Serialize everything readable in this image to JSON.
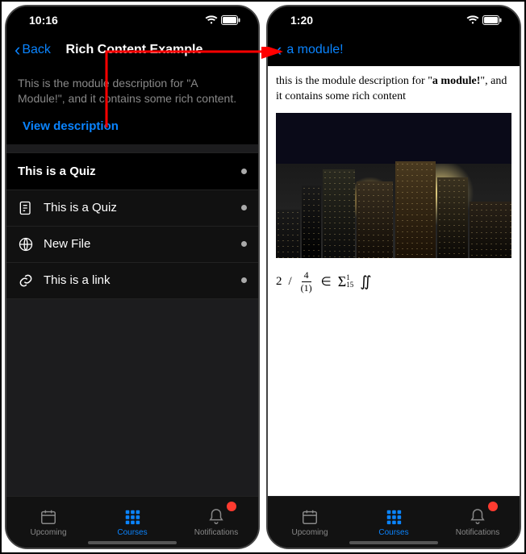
{
  "left": {
    "status_time": "10:16",
    "back_label": "Back",
    "title": "Rich Content Example",
    "description": "This is the module description for \"A Module!\", and it contains some rich content.",
    "view_description": "View description",
    "section_title": "This is a Quiz",
    "items": [
      {
        "label": "This is a Quiz",
        "icon": "quiz"
      },
      {
        "label": "New File",
        "icon": "globe"
      },
      {
        "label": "This is a link",
        "icon": "link"
      }
    ]
  },
  "right": {
    "status_time": "1:20",
    "back_label": "a module!",
    "desc_pre": "this is the module description for \"",
    "desc_bold": "a module!",
    "desc_post": "\", and it contains some rich content",
    "formula_text": "2 / (1)  ∈   Σ  ∬",
    "formula_frac_n": "4",
    "formula_frac_d": "(1)",
    "formula_sup": "1",
    "formula_sub": "15"
  },
  "tabs": [
    {
      "label": "Upcoming",
      "icon": "calendar",
      "active": false,
      "badge": false
    },
    {
      "label": "Courses",
      "icon": "grid",
      "active": true,
      "badge": false
    },
    {
      "label": "Notifications",
      "icon": "bell",
      "active": false,
      "badge": true
    }
  ],
  "colors": {
    "accent": "#0a84ff",
    "badge": "#ff3b30"
  }
}
